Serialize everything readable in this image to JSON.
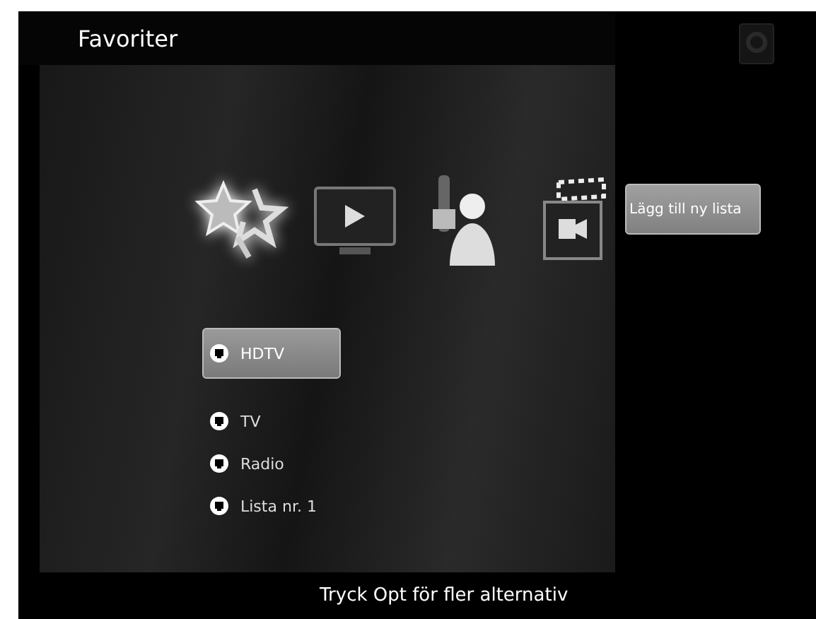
{
  "header": {
    "title": "Favoriter"
  },
  "categories": [
    {
      "kind": "favorites",
      "selected": true
    },
    {
      "kind": "video",
      "selected": false
    },
    {
      "kind": "remote",
      "selected": false
    },
    {
      "kind": "clapper",
      "selected": false
    }
  ],
  "lists": [
    {
      "label": "HDTV",
      "selected": true
    },
    {
      "label": "TV",
      "selected": false
    },
    {
      "label": "Radio",
      "selected": false
    },
    {
      "label": "Lista nr. 1",
      "selected": false
    }
  ],
  "side_action": {
    "label": "Lägg till ny lista"
  },
  "footer": {
    "hint": "Tryck Opt för fler alternativ"
  }
}
